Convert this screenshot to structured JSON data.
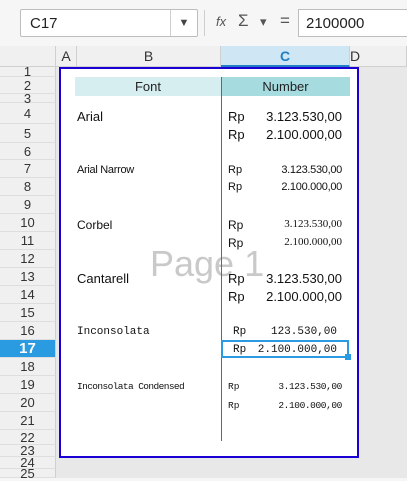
{
  "toolbar": {
    "cell_ref": "C17",
    "dropdown_icon": "▼",
    "function_wizard_icon": "fx",
    "sum_icon": "Σ",
    "sum_dropdown_icon": "▾",
    "equals_icon": "=",
    "formula_value": "2100000"
  },
  "columns": [
    "A",
    "B",
    "C",
    "D"
  ],
  "rows": [
    "1",
    "2",
    "3",
    "4",
    "5",
    "6",
    "7",
    "8",
    "9",
    "10",
    "11",
    "12",
    "13",
    "14",
    "15",
    "16",
    "17",
    "18",
    "19",
    "20",
    "21",
    "22",
    "23",
    "24",
    "25"
  ],
  "active_row": "17",
  "active_column": "C",
  "page_watermark": "Page 1",
  "table": {
    "header_font": "Font",
    "header_number": "Number",
    "rows": [
      {
        "font": "Arial",
        "rp1": "Rp",
        "val1": "3.123.530,00",
        "rp2": "Rp",
        "val2": "2.100.000,00"
      },
      {
        "font": "Arial Narrow",
        "rp1": "Rp",
        "val1": "3.123.530,00",
        "rp2": "Rp",
        "val2": "2.100.000,00"
      },
      {
        "font": "Corbel",
        "rp1": "Rp",
        "val1": "3.123.530,00",
        "rp2": "Rp",
        "val2": "2.100.000,00"
      },
      {
        "font": "Cantarell",
        "rp1": "Rp",
        "val1": "3.123.530,00",
        "rp2": "Rp",
        "val2": "2.100.000,00"
      },
      {
        "font": "Inconsolata",
        "rp1": "Rp",
        "val1": "123.530,00",
        "rp2": "Rp",
        "val2": "2.100.000,00"
      },
      {
        "font": "Inconsolata Condensed",
        "rp1": "Rp",
        "val1": "3.123.530,00",
        "rp2": "Rp",
        "val2": "2.100.000,00"
      }
    ]
  },
  "colors": {
    "accent": "#2a9be0",
    "page_border": "#1a00d4",
    "header_font_bg": "#d6eef0",
    "header_number_bg": "#a6dbe0"
  }
}
